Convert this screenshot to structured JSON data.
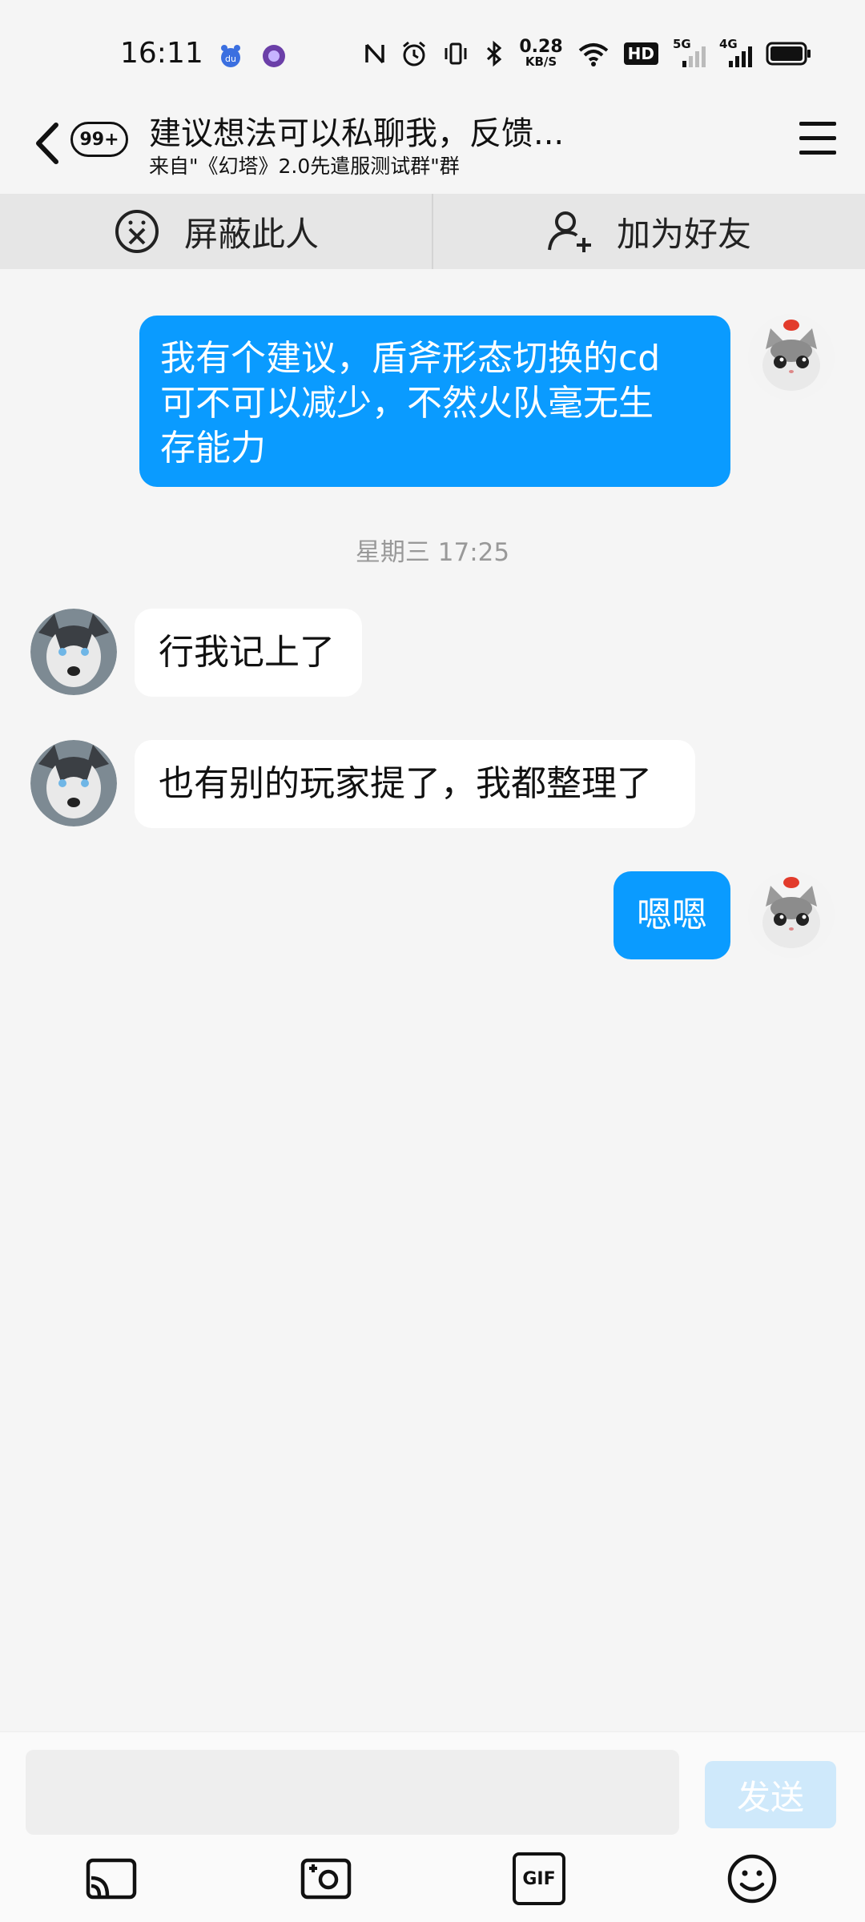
{
  "status_bar": {
    "time": "16:11",
    "net_speed_value": "0.28",
    "net_speed_unit": "KB/S",
    "hd_label": "HD",
    "net1": "5G",
    "net2": "4G"
  },
  "header": {
    "unread_badge": "99+",
    "title": "建议想法可以私聊我，反馈...",
    "subtitle": "来自\"《幻塔》2.0先遣服测试群\"群"
  },
  "actions": {
    "block_label": "屏蔽此人",
    "add_friend_label": "加为好友"
  },
  "messages": [
    {
      "direction": "outgoing",
      "lines": [
        "我有个建议，盾斧形态切换的cd",
        "可不可以减少，不然火队毫无生",
        "存能力"
      ]
    },
    {
      "direction": "incoming",
      "text": "行我记上了"
    },
    {
      "direction": "incoming",
      "text": "也有别的玩家提了，我都整理了"
    },
    {
      "direction": "outgoing",
      "text": "嗯嗯"
    }
  ],
  "timestamp": "星期三 17:25",
  "input": {
    "value": "",
    "placeholder": "",
    "send_label": "发送"
  },
  "toolbar": {
    "gif_label": "GIF"
  },
  "colors": {
    "outgoing_bubble": "#0a9bff",
    "incoming_bubble": "#ffffff",
    "send_disabled": "#cfe9fb",
    "background": "#f5f5f5"
  }
}
